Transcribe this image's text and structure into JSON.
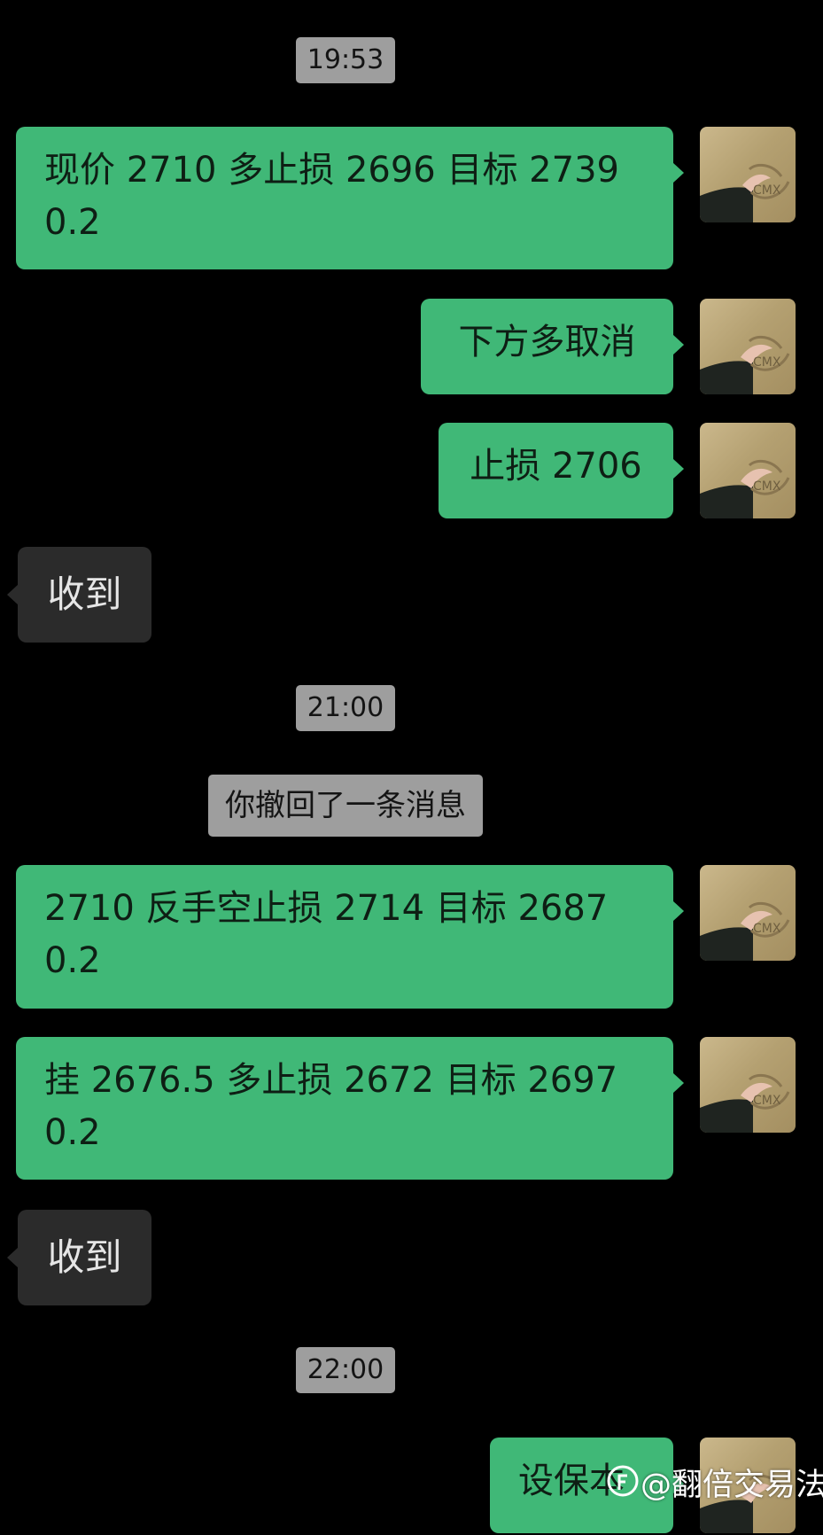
{
  "conversation": {
    "timestamps": [
      "19:53",
      "21:00",
      "22:00"
    ],
    "recall_notice": "你撤回了一条消息",
    "messages": [
      {
        "side": "out",
        "text": "现价 2710 多止损 2696 目标 2739\n0.2"
      },
      {
        "side": "out",
        "text": "下方多取消"
      },
      {
        "side": "out",
        "text": "止损 2706"
      },
      {
        "side": "in",
        "text": "收到"
      },
      {
        "side": "out",
        "text": "2710 反手空止损 2714 目标 2687\n0.2"
      },
      {
        "side": "out",
        "text": "挂 2676.5 多止损 2672  目标 2697\n0.2"
      },
      {
        "side": "in",
        "text": "收到"
      },
      {
        "side": "out",
        "text": "设保本"
      }
    ]
  },
  "watermark": {
    "text": "@翻倍交易法",
    "icon": "platform-logo-icon"
  },
  "colors": {
    "background": "#000000",
    "outgoing_bubble": "#40b877",
    "incoming_bubble": "#2b2b2b",
    "timestamp_pill": "#9e9e9e"
  }
}
